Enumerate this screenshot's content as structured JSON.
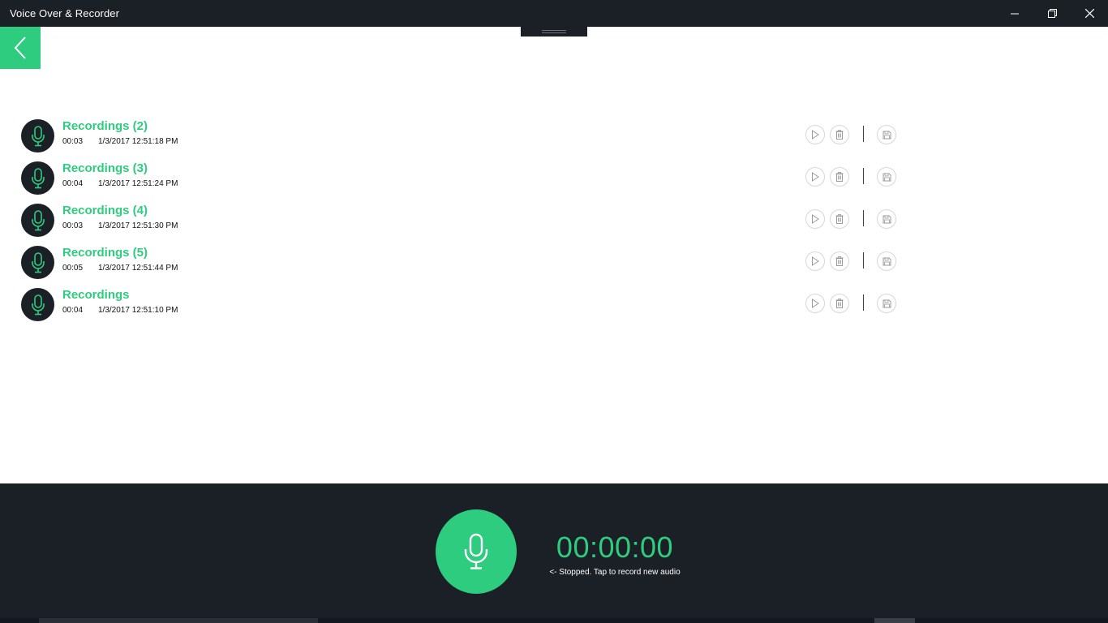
{
  "window": {
    "title": "Voice Over & Recorder",
    "minimize_icon": "minimize-icon",
    "restore_icon": "restore-icon",
    "close_icon": "close-icon"
  },
  "nav": {
    "back_icon": "chevron-left-icon"
  },
  "recordings": [
    {
      "name": "Recordings (2)",
      "duration": "00:03",
      "date": "1/3/2017 12:51:18 PM"
    },
    {
      "name": "Recordings (3)",
      "duration": "00:04",
      "date": "1/3/2017 12:51:24 PM"
    },
    {
      "name": "Recordings (4)",
      "duration": "00:03",
      "date": "1/3/2017 12:51:30 PM"
    },
    {
      "name": "Recordings (5)",
      "duration": "00:05",
      "date": "1/3/2017 12:51:44 PM"
    },
    {
      "name": "Recordings",
      "duration": "00:04",
      "date": "1/3/2017 12:51:10 PM"
    }
  ],
  "recorder": {
    "timer": "00:00:00",
    "status": "<- Stopped. Tap to record new audio"
  },
  "colors": {
    "accent": "#2ecc7f",
    "dark": "#1b1f26"
  }
}
